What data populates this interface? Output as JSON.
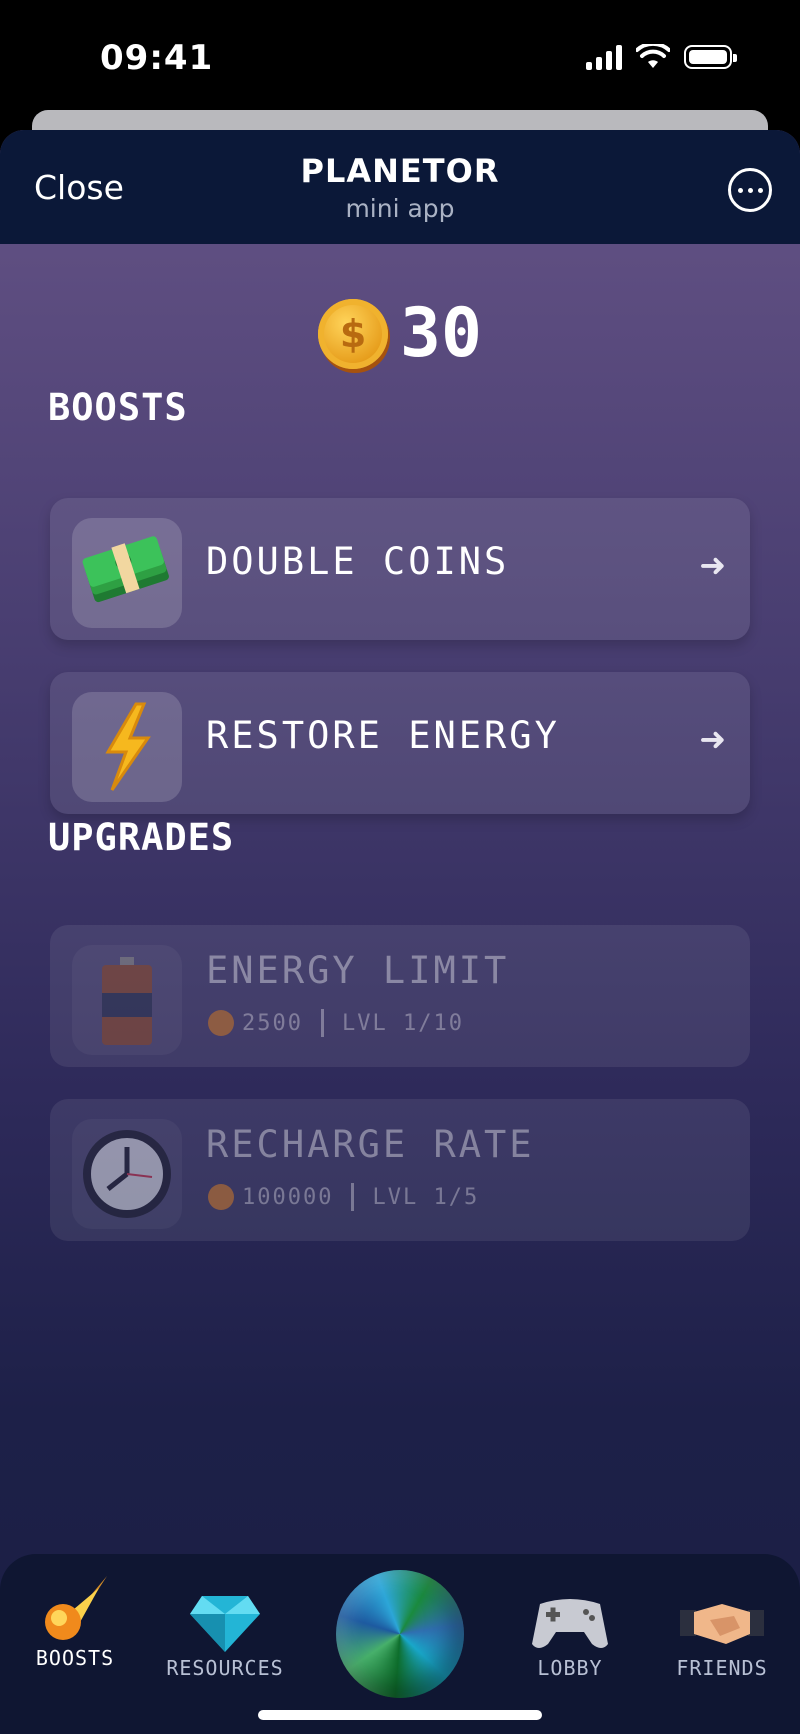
{
  "status_bar": {
    "time": "09:41"
  },
  "header": {
    "close_label": "Close",
    "title": "PLANETOR",
    "subtitle": "mini app"
  },
  "balance": {
    "value": "30",
    "coin_symbol": "$"
  },
  "boosts": {
    "title": "BOOSTS",
    "items": [
      {
        "label": "DOUBLE COINS",
        "icon": "money-stack-icon",
        "arrow": "➜"
      },
      {
        "label": "RESTORE ENERGY",
        "icon": "lightning-icon",
        "arrow": "➜"
      }
    ]
  },
  "upgrades": {
    "title": "UPGRADES",
    "items": [
      {
        "label": "ENERGY LIMIT",
        "icon": "battery-icon",
        "cost": "2500",
        "level": "LVL 1/10"
      },
      {
        "label": "RECHARGE RATE",
        "icon": "clock-icon",
        "cost": "100000",
        "level": "LVL 1/5"
      }
    ]
  },
  "tabbar": {
    "tabs": [
      {
        "label": "BOOSTS",
        "icon": "comet-icon",
        "active": true
      },
      {
        "label": "RESOURCES",
        "icon": "diamond-icon",
        "active": false
      },
      {
        "label": "",
        "icon": "planet-icon",
        "active": false
      },
      {
        "label": "LOBBY",
        "icon": "gamepad-icon",
        "active": false
      },
      {
        "label": "FRIENDS",
        "icon": "handshake-icon",
        "active": false
      }
    ]
  }
}
